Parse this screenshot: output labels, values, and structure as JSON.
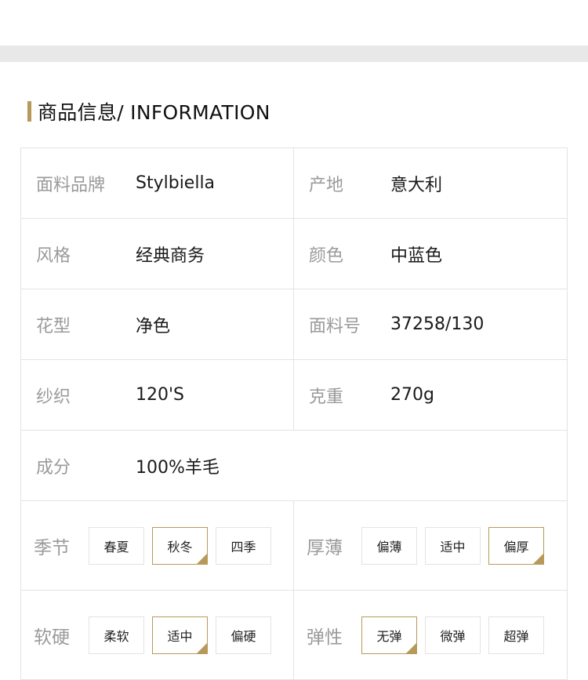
{
  "section": {
    "title": "商品信息/ INFORMATION"
  },
  "info": {
    "fabric_brand": {
      "label": "面料品牌",
      "value": "Stylbiella"
    },
    "origin": {
      "label": "产地",
      "value": "意大利"
    },
    "style": {
      "label": "风格",
      "value": "经典商务"
    },
    "color": {
      "label": "颜色",
      "value": "中蓝色"
    },
    "pattern": {
      "label": "花型",
      "value": "净色"
    },
    "fabric_no": {
      "label": "面料号",
      "value": "37258/130"
    },
    "yarn": {
      "label": "纱织",
      "value": "120'S"
    },
    "weight": {
      "label": "克重",
      "value": "270g"
    },
    "composition": {
      "label": "成分",
      "value": "100%羊毛"
    }
  },
  "attributes": {
    "season": {
      "label": "季节",
      "options": [
        "春夏",
        "秋冬",
        "四季"
      ],
      "selected": "秋冬"
    },
    "thickness": {
      "label": "厚薄",
      "options": [
        "偏薄",
        "适中",
        "偏厚"
      ],
      "selected": "偏厚"
    },
    "softness": {
      "label": "软硬",
      "options": [
        "柔软",
        "适中",
        "偏硬"
      ],
      "selected": "适中"
    },
    "elasticity": {
      "label": "弹性",
      "options": [
        "无弹",
        "微弹",
        "超弹"
      ],
      "selected": "无弹"
    }
  },
  "colors": {
    "accent": "#b79a5a",
    "label_gray": "#9a9a9a",
    "border": "#e3e3e3",
    "band": "#e8e8e8"
  }
}
